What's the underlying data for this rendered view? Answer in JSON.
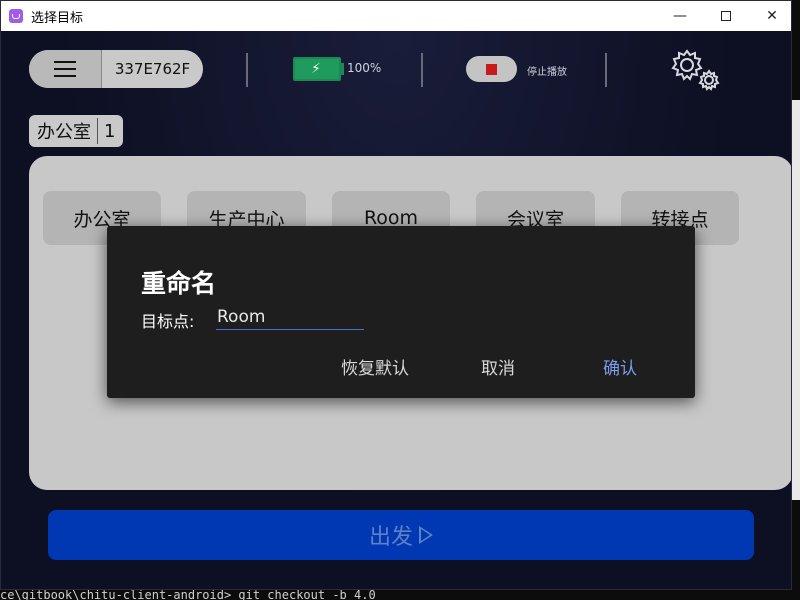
{
  "window": {
    "title": "选择目标",
    "min_glyph": "—",
    "close_glyph": "✕"
  },
  "header": {
    "device_id": "337E762F",
    "battery_percent": "100%",
    "battery_level": 1.0,
    "stop_label": "停止播放"
  },
  "location": {
    "name": "办公室",
    "count": "1"
  },
  "targets": [
    {
      "label": "办公室"
    },
    {
      "label": "生产中心"
    },
    {
      "label": "Room"
    },
    {
      "label": "会议室"
    },
    {
      "label": "转接点"
    }
  ],
  "go_button": {
    "label": "出发"
  },
  "dialog": {
    "title": "重命名",
    "field_label": "目标点:",
    "field_value": "Room",
    "reset_label": "恢复默认",
    "cancel_label": "取消",
    "confirm_label": "确认"
  },
  "colors": {
    "accent_blue": "#0037b3",
    "confirm_text": "#7a9cf0",
    "battery_green": "#1f9b5e",
    "stop_red": "#c81a1a"
  },
  "background_terminal": {
    "bottom_line": "ce\\gitbook\\chitu-client-android> git checkout -b 4.0"
  }
}
